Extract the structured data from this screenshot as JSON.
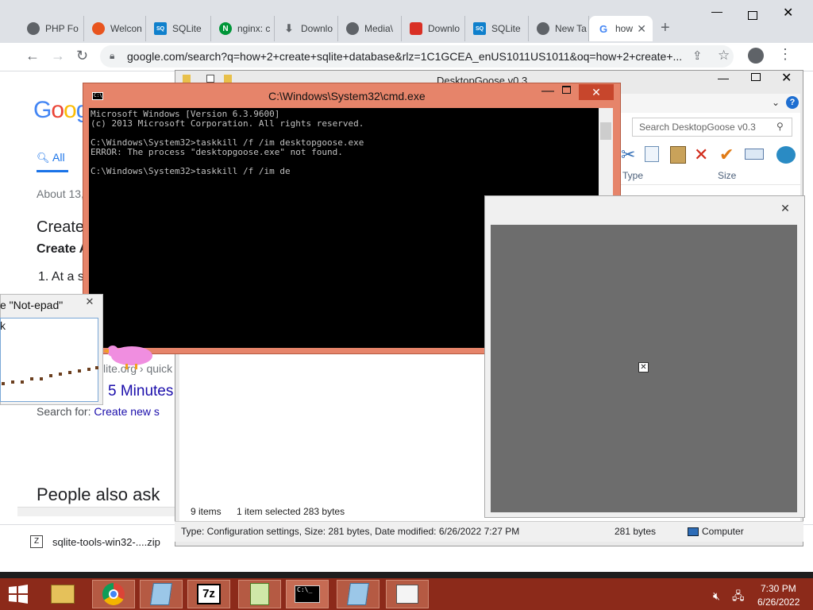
{
  "chrome": {
    "tabs": [
      {
        "label": "PHP Fo",
        "icon": "chrome-icon",
        "color": "#5f6368"
      },
      {
        "label": "Welcon",
        "icon": "red-app-icon",
        "color": "#e8541e"
      },
      {
        "label": "SQLite",
        "icon": "sqlite-icon",
        "color": "#0f80cc"
      },
      {
        "label": "nginx: c",
        "icon": "nginx-icon",
        "color": "#009639"
      },
      {
        "label": "Downlo",
        "icon": "download-icon",
        "color": "#5f6368"
      },
      {
        "label": "Media\\",
        "icon": "chrome-icon",
        "color": "#5f6368"
      },
      {
        "label": "Downlo",
        "icon": "red-download-icon",
        "color": "#d93025"
      },
      {
        "label": "SQLite",
        "icon": "sqlite-icon",
        "color": "#0f80cc"
      },
      {
        "label": "New Ta",
        "icon": "chrome-icon",
        "color": "#5f6368"
      },
      {
        "label": "how",
        "icon": "google-icon",
        "color": "#4285f4"
      }
    ],
    "new_tab": "+",
    "url": "google.com/search?q=how+2+create+sqlite+database&rlz=1C1GCEA_enUS1011US1011&oq=how+2+create+...",
    "page": {
      "logo": "Goog",
      "tab_all": "All",
      "results_count": "About 13,",
      "result_title": "Create",
      "result_subtitle": "Create A",
      "result_step": "1. At a s",
      "result_cite": "lite.org › quick",
      "result_link": "5 Minutes",
      "result_search_prefix": "Search for: ",
      "result_search_link": "Create new s",
      "people_also_ask": "People also ask"
    },
    "download": "sqlite-tools-win32-....zip"
  },
  "explorer": {
    "title": "DesktopGoose v0.3",
    "search_placeholder": "Search DesktopGoose v0.3",
    "col_type": "Type",
    "col_size": "Size",
    "items_count": "9 items",
    "selection": "1 item selected  283 bytes",
    "details": "Type: Configuration settings, Size: 281 bytes, Date modified: 6/26/2022 7:27 PM",
    "details_size": "281 bytes",
    "details_location": "Computer"
  },
  "cmd": {
    "title": "C:\\Windows\\System32\\cmd.exe",
    "lines": [
      "Microsoft Windows [Version 6.3.9600]",
      "(c) 2013 Microsoft Corporation. All rights reserved.",
      "",
      "C:\\Windows\\System32>taskkill /f /im desktopgoose.exe",
      "ERROR: The process \"desktopgoose.exe\" not found.",
      "",
      "C:\\Windows\\System32>taskkill /f /im de"
    ]
  },
  "notepad": {
    "title": "e \"Not-epad\"",
    "text": "k"
  },
  "taskbar": {
    "time": "7:30 PM",
    "date": "6/26/2022",
    "items": [
      "start-icon",
      "file-explorer-icon",
      "chrome-icon",
      "notepad-icon",
      "7zip-icon",
      "notepad-plus-icon",
      "cmd-icon",
      "notepad-icon",
      "window-icon"
    ]
  },
  "colors": {
    "taskbar": "#8c2a1a",
    "cmd_frame": "#e6846a",
    "google_blue": "#1a73e8",
    "link": "#1a0dab"
  }
}
